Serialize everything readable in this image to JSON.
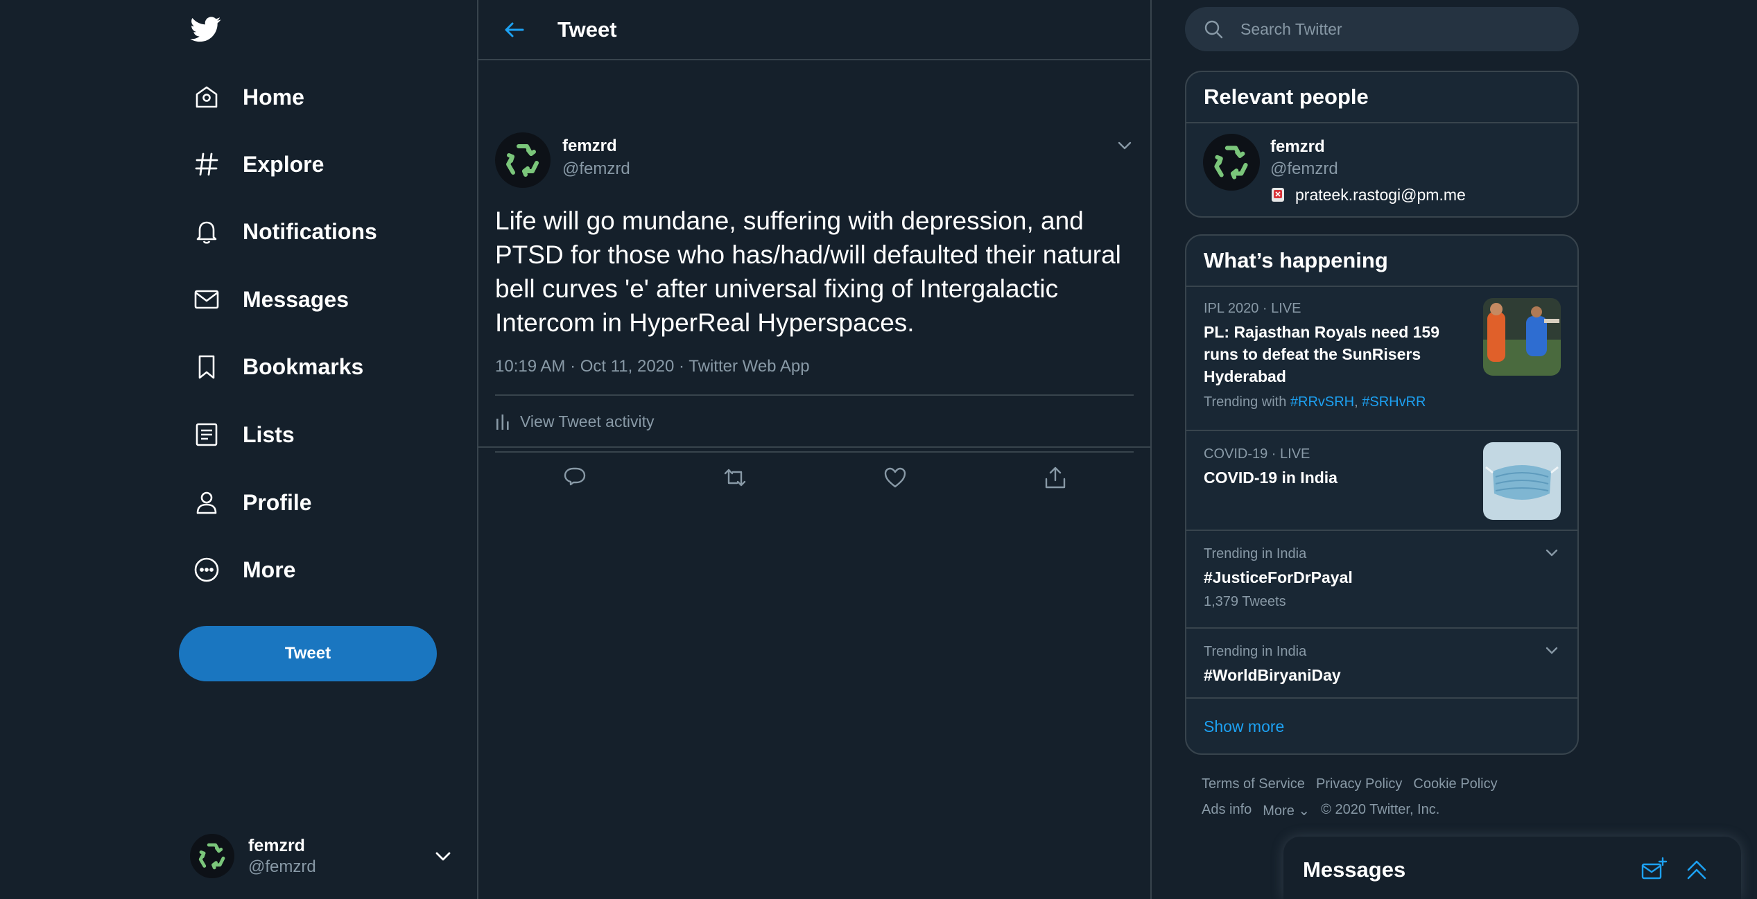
{
  "nav": {
    "items": [
      {
        "label": "Home",
        "icon": "home-icon"
      },
      {
        "label": "Explore",
        "icon": "hashtag-icon"
      },
      {
        "label": "Notifications",
        "icon": "bell-icon"
      },
      {
        "label": "Messages",
        "icon": "envelope-icon"
      },
      {
        "label": "Bookmarks",
        "icon": "bookmark-icon"
      },
      {
        "label": "Lists",
        "icon": "list-icon"
      },
      {
        "label": "Profile",
        "icon": "person-icon"
      },
      {
        "label": "More",
        "icon": "more-circle-icon"
      }
    ],
    "tweet_button": "Tweet",
    "account": {
      "name": "femzrd",
      "handle": "@femzrd"
    }
  },
  "main": {
    "title": "Tweet",
    "tweet": {
      "name": "femzrd",
      "handle": "@femzrd",
      "text": "Life will go mundane, suffering with depression, and PTSD for those who has/had/will defaulted their natural bell curves 'e' after universal fixing of Intergalactic Intercom in HyperReal Hyperspaces.",
      "meta": "10:19 AM · Oct 11, 2020 · Twitter Web App",
      "activity": "View Tweet activity"
    }
  },
  "search": {
    "placeholder": "Search Twitter"
  },
  "relevant_people": {
    "title": "Relevant people",
    "person": {
      "name": "femzrd",
      "handle": "@femzrd",
      "bio": "prateek.rastogi@pm.me"
    }
  },
  "whats_happening": {
    "title": "What’s happening",
    "trends": [
      {
        "context": "IPL 2020 · LIVE",
        "title": "PL: Rajasthan Royals need 159 runs to defeat the SunRisers Hyderabad",
        "sub_prefix": "Trending with ",
        "tag1": "#RRvSRH",
        "sep": ", ",
        "tag2": "#SRHvRR"
      },
      {
        "context": "COVID-19 · LIVE",
        "title": "COVID-19 in India"
      },
      {
        "context": "Trending in India",
        "title": "#JusticeForDrPayal",
        "sub": "1,379 Tweets"
      },
      {
        "context": "Trending in India",
        "title": "#WorldBiryaniDay"
      }
    ],
    "show_more": "Show more"
  },
  "footer": {
    "terms": "Terms of Service",
    "privacy": "Privacy Policy",
    "cookie": "Cookie Policy",
    "ads": "Ads info",
    "more": "More",
    "copyright": "© 2020 Twitter, Inc."
  },
  "drawer": {
    "title": "Messages"
  },
  "colors": {
    "background": "#15202b",
    "panel": "#192734",
    "accent": "#1da1f2",
    "tweet_button": "#1a76c0",
    "muted": "#8899a6",
    "border": "#38444d"
  }
}
